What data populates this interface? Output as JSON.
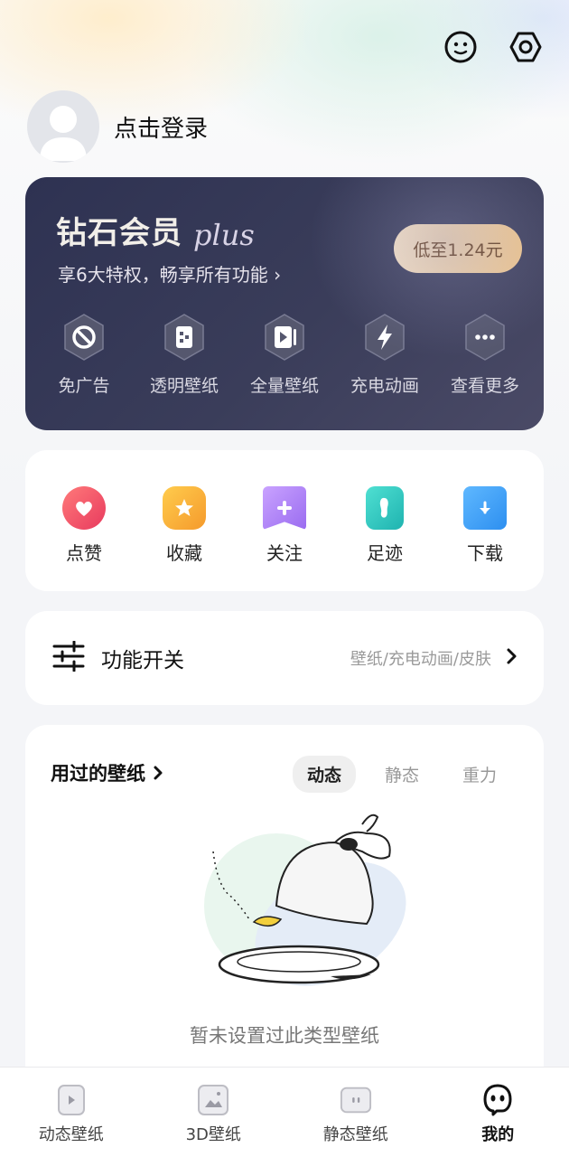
{
  "header": {
    "icons": [
      "smiley-face-icon",
      "settings-hexagon-icon"
    ]
  },
  "profile": {
    "login_label": "点击登录"
  },
  "vip": {
    "title": "钻石会员",
    "title_script": "plus",
    "subtitle": "享6大特权，畅享所有功能 ›",
    "price_button": "低至1.24元",
    "perks": [
      {
        "label": "免广告",
        "icon": "no-ads-icon"
      },
      {
        "label": "透明壁纸",
        "icon": "transparent-wallpaper-icon"
      },
      {
        "label": "全量壁纸",
        "icon": "all-wallpapers-icon"
      },
      {
        "label": "充电动画",
        "icon": "charging-bolt-icon"
      },
      {
        "label": "查看更多",
        "icon": "more-dots-icon"
      }
    ],
    "colors": {
      "card_bg": "#2e3252",
      "price_bg": "#f3c98f"
    }
  },
  "quick_actions": [
    {
      "label": "点赞",
      "icon": "heart-icon",
      "color": "#f05a6e"
    },
    {
      "label": "收藏",
      "icon": "star-icon",
      "color": "#f7b43c"
    },
    {
      "label": "关注",
      "icon": "plus-bookmark-icon",
      "color": "#b98af0"
    },
    {
      "label": "足迹",
      "icon": "footprint-icon",
      "color": "#2ec9c0"
    },
    {
      "label": "下载",
      "icon": "download-folder-icon",
      "color": "#3a9cf0"
    }
  ],
  "function_switch": {
    "title": "功能开关",
    "subtitle": "壁纸/充电动画/皮肤"
  },
  "used_wallpapers": {
    "title": "用过的壁纸",
    "tabs": [
      "动态",
      "静态",
      "重力"
    ],
    "active_tab": "动态",
    "empty_text": "暂未设置过此类型壁纸"
  },
  "tabbar": {
    "tabs": [
      {
        "label": "动态壁纸",
        "icon": "play-card-icon"
      },
      {
        "label": "3D壁纸",
        "icon": "3d-image-icon"
      },
      {
        "label": "静态壁纸",
        "icon": "static-image-icon"
      },
      {
        "label": "我的",
        "icon": "ghost-face-icon"
      }
    ],
    "active": "我的"
  }
}
